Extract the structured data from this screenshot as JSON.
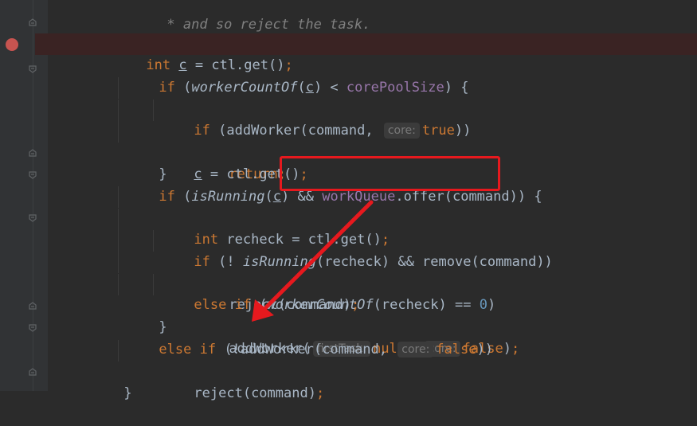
{
  "colors": {
    "background": "#2b2b2b",
    "keyword": "#cc7832",
    "field": "#9876aa",
    "number": "#6897bb",
    "comment": "#808080",
    "default_text": "#a9b7c6",
    "breakpoint": "#c75450",
    "annotation": "#e6191e"
  },
  "code": {
    "l1": {
      "comment": "* and so reject the task."
    },
    "l2": {
      "comment": "*/"
    },
    "l3": {
      "kw": "int",
      "var": "c",
      "rest": " = ctl.get()",
      "semi": ";"
    },
    "l4": {
      "kw": "if",
      "open": " (",
      "fn": "workerCountOf",
      "p1": "(",
      "var": "c",
      "p2": ") < ",
      "field": "corePoolSize",
      "close": ") {"
    },
    "l5": {
      "kw": "if",
      "open": " (addWorker(command, ",
      "hint": "core:",
      "val": "true",
      "close": "))"
    },
    "l6": {
      "kw": "return",
      "semi": ";"
    },
    "l7": {
      "var": "c",
      "rest": " = ctl.get()",
      "semi": ";"
    },
    "l8": {
      "text": "}"
    },
    "l9": {
      "kw": "if",
      "open": " (",
      "fn": "isRunning",
      "p1": "(",
      "var": "c",
      "p2": ") && ",
      "field": "workQueue",
      "call": ".offer(command)) {"
    },
    "l10": {
      "kw": "int",
      "rest": " recheck = ctl.get()",
      "semi": ";"
    },
    "l11": {
      "kw": "if",
      "open": " (! ",
      "fn": "isRunning",
      "rest": "(recheck) && remove(command))"
    },
    "l12": {
      "rest": "reject(command)",
      "semi": ";"
    },
    "l13": {
      "kw": "else if",
      "open": " (",
      "fn": "workerCountOf",
      "rest": "(recheck) == ",
      "num": "0",
      "close": ")"
    },
    "l14": {
      "rest": "addWorker(",
      "hint1": "firstTask:",
      "kw1": "null",
      "comma": ", ",
      "hint2": "core:",
      "kw2": "false",
      "close": ")",
      "semi": ";"
    },
    "l15": {
      "text": "}"
    },
    "l16": {
      "kw": "else if",
      "open": " (!addWorker(command, ",
      "hint": "core:",
      "val": "false",
      "close": "))"
    },
    "l17": {
      "rest": "reject(command)",
      "semi": ";"
    },
    "l18": {
      "text": "}"
    }
  },
  "annotations": {
    "highlight": "workQueue.offer(command)",
    "arrow_target": "else if (!addWorker(command, core: false))"
  }
}
